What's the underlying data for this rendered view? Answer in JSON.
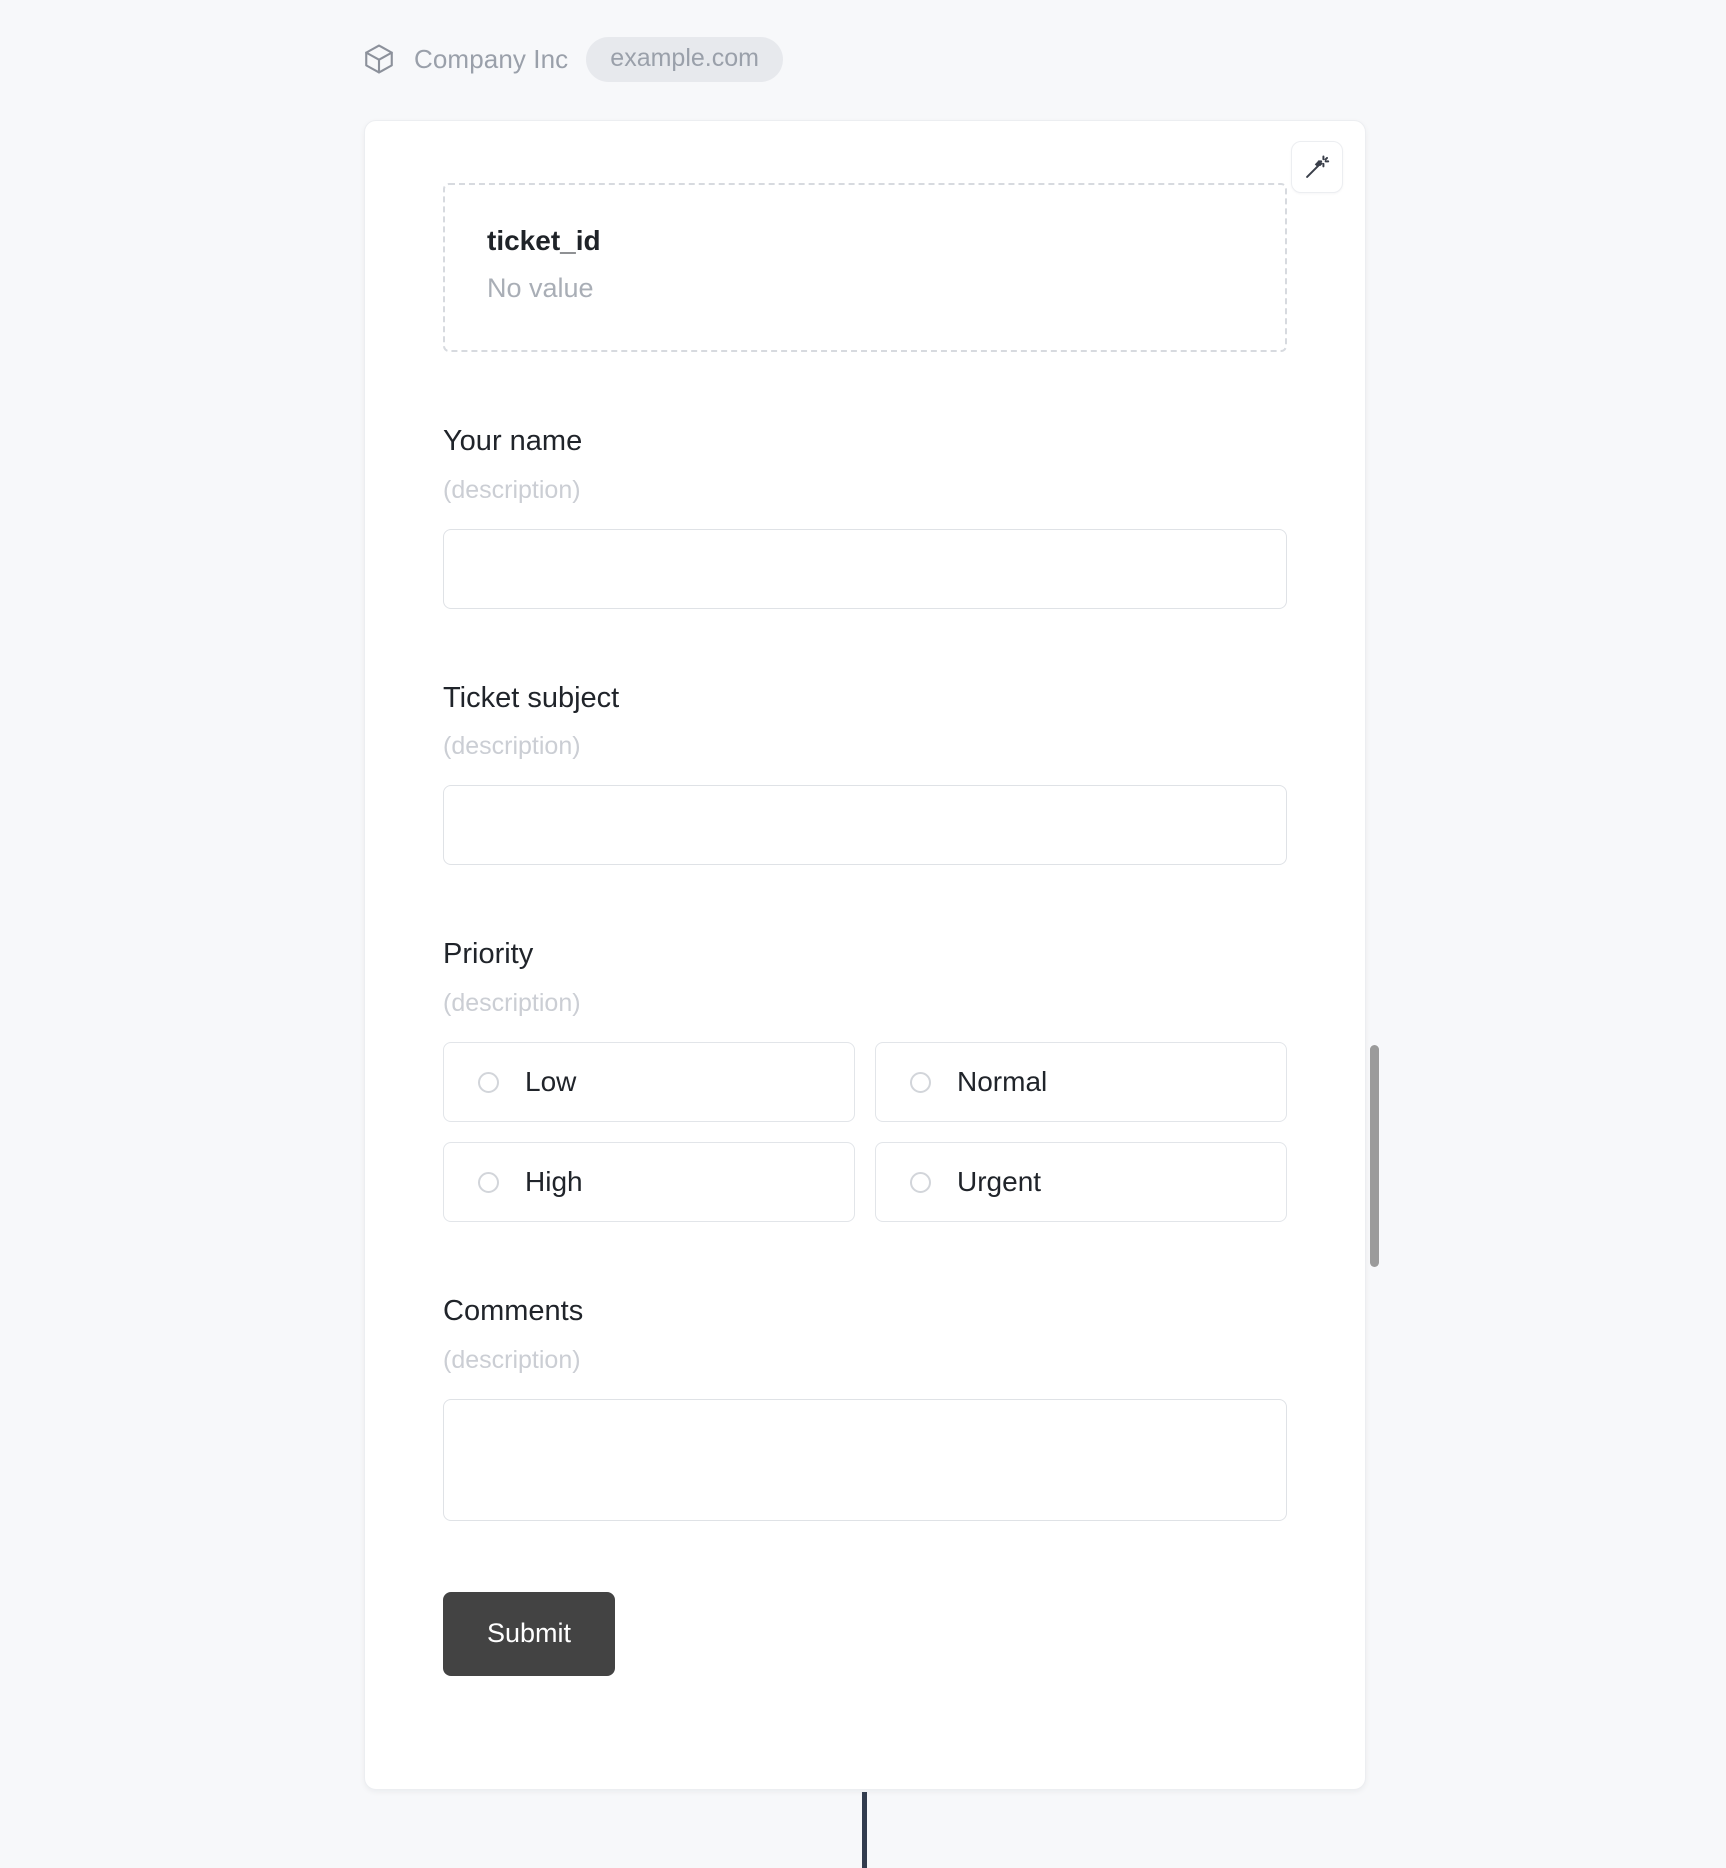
{
  "header": {
    "logo_icon": "cube-icon",
    "company_name": "Company Inc",
    "domain_badge": "example.com"
  },
  "card": {
    "magic_button": {
      "icon": "magic-wand-icon",
      "label": ""
    },
    "readonly_token": {
      "key": "ticket_id",
      "value": "No value"
    },
    "fields": [
      {
        "name": "your-name",
        "label": "Your name",
        "description": "(description)",
        "type": "text",
        "value": "",
        "placeholder": ""
      },
      {
        "name": "ticket-subject",
        "label": "Ticket subject",
        "description": "(description)",
        "type": "text",
        "value": "",
        "placeholder": ""
      },
      {
        "name": "priority",
        "label": "Priority",
        "description": "(description)",
        "type": "radio",
        "selected": "",
        "options": [
          "Low",
          "Normal",
          "High",
          "Urgent"
        ]
      },
      {
        "name": "comments",
        "label": "Comments",
        "description": "(description)",
        "type": "textarea",
        "value": "",
        "placeholder": ""
      }
    ],
    "submit_label": "Submit"
  },
  "colors": {
    "page_background": "#f7f8fa",
    "card_background": "#ffffff",
    "submit_background": "#434343",
    "badge_background": "#e7e9ed",
    "muted_text": "#9aa0aa",
    "description_text": "#cbced4",
    "scrollbar_thumb": "#9b9b9b",
    "bottom_line": "#323c4e"
  }
}
